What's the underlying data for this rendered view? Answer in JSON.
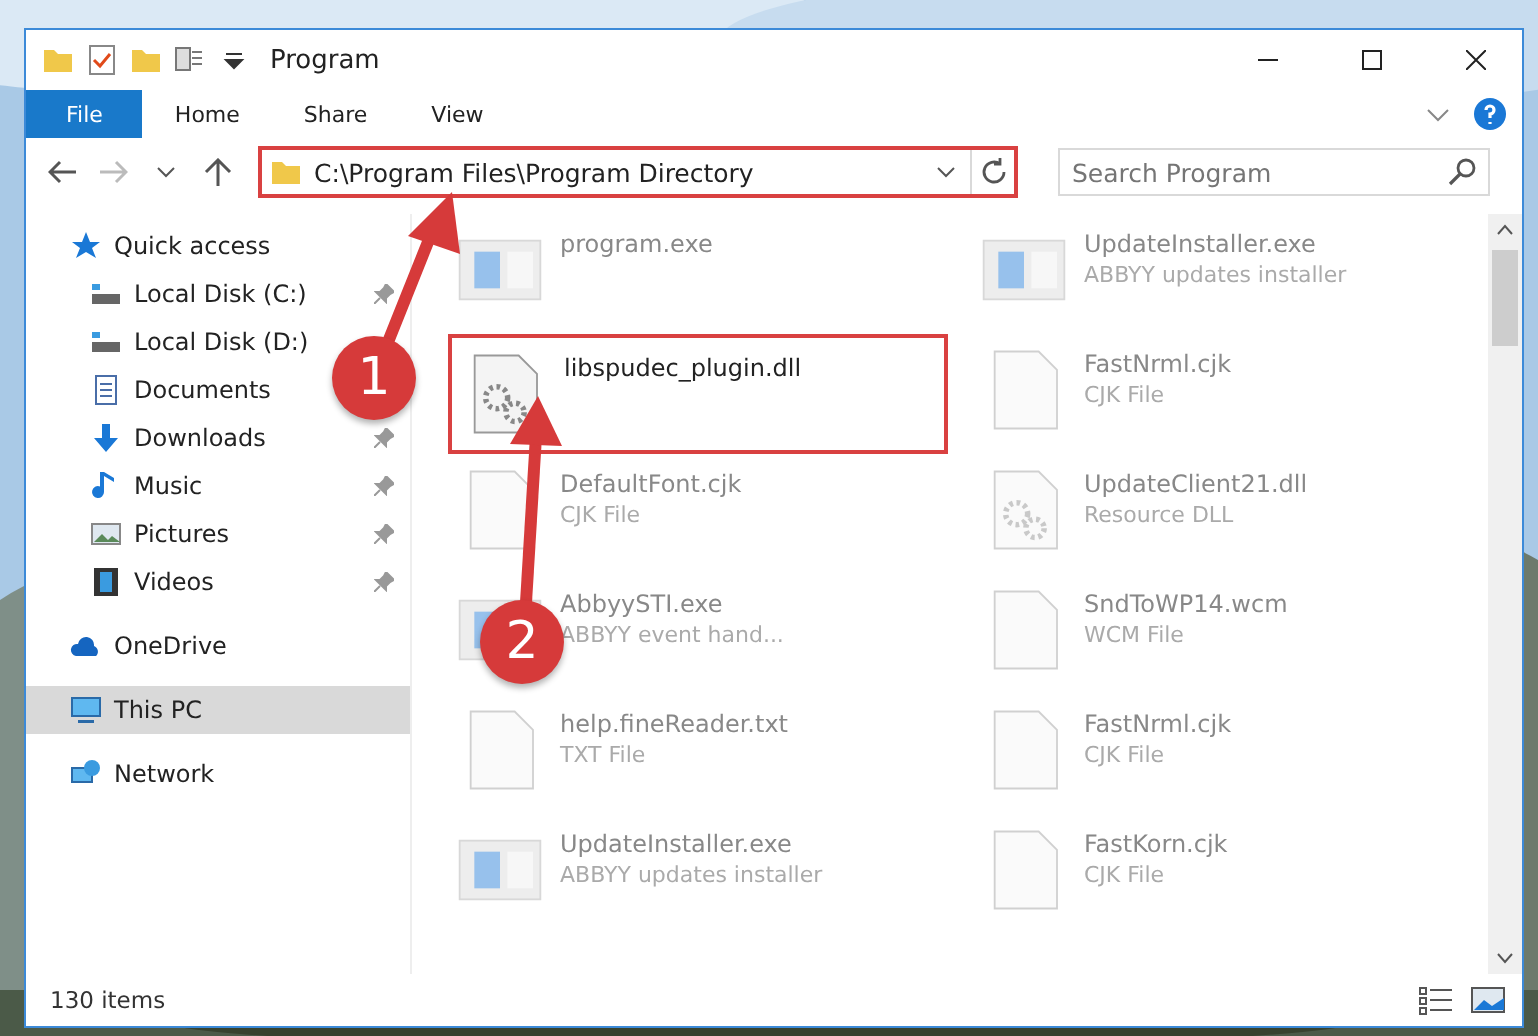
{
  "window": {
    "title": "Program"
  },
  "ribbon_tabs": [
    {
      "label": "File",
      "selected": true
    },
    {
      "label": "Home",
      "selected": false
    },
    {
      "label": "Share",
      "selected": false
    },
    {
      "label": "View",
      "selected": false
    }
  ],
  "address": {
    "path": "C:\\Program Files\\Program Directory",
    "highlighted": true
  },
  "search": {
    "placeholder": "Search Program"
  },
  "sidebar": {
    "items": [
      {
        "label": "Quick access",
        "kind": "star",
        "selected": false,
        "pinned": false,
        "children": [
          {
            "label": "Local Disk (C:)",
            "kind": "disk",
            "selected": false,
            "pinned": true
          },
          {
            "label": "Local Disk (D:)",
            "kind": "disk",
            "selected": false,
            "pinned": false
          },
          {
            "label": "Documents",
            "kind": "docs",
            "selected": false,
            "pinned": false
          },
          {
            "label": "Downloads",
            "kind": "download",
            "selected": false,
            "pinned": true
          },
          {
            "label": "Music",
            "kind": "music",
            "selected": false,
            "pinned": true
          },
          {
            "label": "Pictures",
            "kind": "pictures",
            "selected": false,
            "pinned": true
          },
          {
            "label": "Videos",
            "kind": "videos",
            "selected": false,
            "pinned": true
          }
        ]
      },
      {
        "label": "OneDrive",
        "kind": "cloud",
        "selected": false,
        "pinned": false
      },
      {
        "label": "This PC",
        "kind": "pc",
        "selected": true,
        "pinned": false
      },
      {
        "label": "Network",
        "kind": "network",
        "selected": false,
        "pinned": false
      }
    ]
  },
  "files": [
    {
      "name": "program.exe",
      "kind": "exe",
      "highlighted": false
    },
    {
      "name": "UpdateInstaller.exe",
      "type": "ABBYY updates installer",
      "kind": "exe",
      "highlighted": false
    },
    {
      "name": "libspudec_plugin.dll",
      "kind": "dll",
      "highlighted": true
    },
    {
      "name": "FastNrml.cjk",
      "type": "CJK File",
      "kind": "doc",
      "highlighted": false
    },
    {
      "name": "DefaultFont.cjk",
      "type": "CJK File",
      "kind": "doc",
      "highlighted": false
    },
    {
      "name": "UpdateClient21.dll",
      "type": "Resource DLL",
      "kind": "dll",
      "highlighted": false
    },
    {
      "name": "AbbyySTI.exe",
      "type": "ABBYY event hand...",
      "kind": "exe",
      "highlighted": false
    },
    {
      "name": "SndToWP14.wcm",
      "type": "WCM File",
      "kind": "doc",
      "highlighted": false
    },
    {
      "name": "help.fineReader.txt",
      "type": "TXT File",
      "kind": "doc",
      "highlighted": false
    },
    {
      "name": "FastNrml.cjk",
      "type": "CJK File",
      "kind": "doc",
      "highlighted": false
    },
    {
      "name": "UpdateInstaller.exe",
      "type": "ABBYY updates installer",
      "kind": "exe",
      "highlighted": false
    },
    {
      "name": "FastKorn.cjk",
      "type": "CJK File",
      "kind": "doc",
      "highlighted": false
    }
  ],
  "status_bar": {
    "count": "130 items"
  },
  "annotations": [
    {
      "number": "1"
    },
    {
      "number": "2"
    }
  ]
}
